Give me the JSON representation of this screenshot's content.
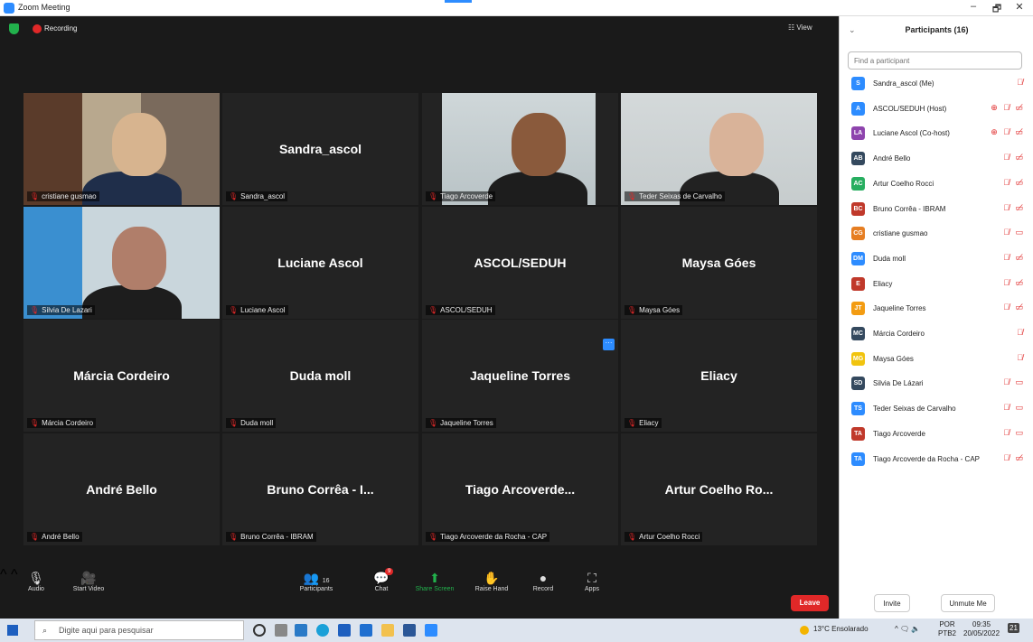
{
  "window": {
    "title": "Zoom Meeting",
    "min": "–",
    "max": "🗗",
    "close": "✕"
  },
  "top": {
    "recording": "Recording",
    "view": "☷ View"
  },
  "tiles": [
    {
      "name": "cristiane gusmao",
      "big": ""
    },
    {
      "name": "Sandra_ascol",
      "big": "Sandra_ascol"
    },
    {
      "name": "Tiago Arcoverde",
      "big": ""
    },
    {
      "name": "Teder Seixas de Carvalho",
      "big": ""
    },
    {
      "name": "Silvia De Lazari",
      "big": ""
    },
    {
      "name": "Luciane Ascol",
      "big": "Luciane Ascol"
    },
    {
      "name": "ASCOL/SEDUH",
      "big": "ASCOL/SEDUH"
    },
    {
      "name": "Maysa Góes",
      "big": "Maysa Góes"
    },
    {
      "name": "Márcia Cordeiro",
      "big": "Márcia Cordeiro"
    },
    {
      "name": "Duda moll",
      "big": "Duda moll"
    },
    {
      "name": "Jaqueline Torres",
      "big": "Jaqueline Torres"
    },
    {
      "name": "Eliacy",
      "big": "Eliacy"
    },
    {
      "name": "André Bello",
      "big": "André Bello"
    },
    {
      "name": "Bruno Corrêa - IBRAM",
      "big": "Bruno Corrêa - I..."
    },
    {
      "name": "Tiago Arcoverde da Rocha - CAP",
      "big": "Tiago Arcoverde..."
    },
    {
      "name": "Artur Coelho Rocci",
      "big": "Artur Coelho Ro..."
    }
  ],
  "toolbar": {
    "audio": "Audio",
    "start_video": "Start Video",
    "participants": "Participants",
    "participants_count": "16",
    "chat": "Chat",
    "chat_badge": "9",
    "share": "Share Screen",
    "raise": "Raise Hand",
    "record": "Record",
    "apps": "Apps",
    "leave": "Leave"
  },
  "panel": {
    "title": "Participants (16)",
    "search_placeholder": "Find a participant",
    "participants": [
      {
        "initials": "S",
        "color": "#2d8cff",
        "name": "Sandra_ascol (Me)",
        "icons": "🎙̸"
      },
      {
        "initials": "A",
        "color": "#2d8cff",
        "name": "ASCOL/SEDUH (Host)",
        "icons": "⊕ 🎙̸ ▭̸"
      },
      {
        "initials": "LA",
        "color": "#8e44ad",
        "name": "Luciane Ascol (Co-host)",
        "icons": "⊕ 🎙̸ ▭̸"
      },
      {
        "initials": "AB",
        "color": "#34495e",
        "name": "André Bello",
        "icons": "🎙̸ ▭̸"
      },
      {
        "initials": "AC",
        "color": "#27ae60",
        "name": "Artur Coelho Rocci",
        "icons": "🎙̸ ▭̸"
      },
      {
        "initials": "BC",
        "color": "#c0392b",
        "name": "Bruno Corrêa - IBRAM",
        "icons": "🎙̸ ▭̸"
      },
      {
        "initials": "CG",
        "color": "#e67e22",
        "name": "cristiane gusmao",
        "icons": "🎙̸ ▭"
      },
      {
        "initials": "DM",
        "color": "#2d8cff",
        "name": "Duda moll",
        "icons": "🎙̸ ▭̸"
      },
      {
        "initials": "E",
        "color": "#c0392b",
        "name": "Eliacy",
        "icons": "🎙̸ ▭̸"
      },
      {
        "initials": "JT",
        "color": "#f39c12",
        "name": "Jaqueline Torres",
        "icons": "🎙̸ ▭̸"
      },
      {
        "initials": "MC",
        "color": "#34495e",
        "name": "Márcia Cordeiro",
        "icons": "🎙̸"
      },
      {
        "initials": "MG",
        "color": "#f1c40f",
        "name": "Maysa Góes",
        "icons": "🎙̸"
      },
      {
        "initials": "SD",
        "color": "#34495e",
        "name": "Silvia De Lázari",
        "icons": "🎙̸ ▭"
      },
      {
        "initials": "TS",
        "color": "#2d8cff",
        "name": "Teder Seixas de Carvalho",
        "icons": "🎙̸ ▭"
      },
      {
        "initials": "TA",
        "color": "#c0392b",
        "name": "Tiago Arcoverde",
        "icons": "🎙̸ ▭"
      },
      {
        "initials": "TA",
        "color": "#2d8cff",
        "name": "Tiago Arcoverde da Rocha - CAP",
        "icons": "🎙̸ ▭̸"
      }
    ],
    "invite": "Invite",
    "unmute": "Unmute Me"
  },
  "taskbar": {
    "search": "Digite aqui para pesquisar",
    "weather": "13°C Ensolarado",
    "lang": "POR",
    "lang2": "PTB2",
    "time": "09:35",
    "date": "20/05/2022",
    "notif": "21"
  }
}
